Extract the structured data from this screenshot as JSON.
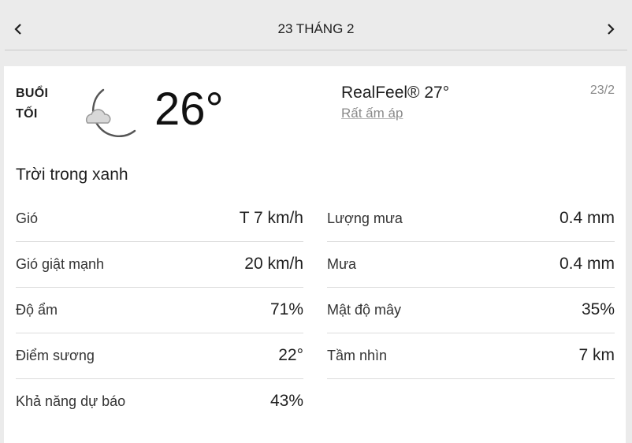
{
  "nav": {
    "prev_icon": "chevron-left-icon",
    "title": "23 THÁNG 2",
    "next_icon": "chevron-right-icon"
  },
  "forecast": {
    "period_line1": "BUỔI",
    "period_line2": "TỐI",
    "icon": "moon-cloud-icon",
    "temperature": "26°",
    "realfeel": "RealFeel® 27°",
    "realfeel_phrase": "Rất ấm áp",
    "date": "23/2",
    "condition": "Trời trong xanh"
  },
  "details_left": [
    {
      "label": "Gió",
      "value": "T 7 km/h"
    },
    {
      "label": "Gió giật mạnh",
      "value": "20 km/h"
    },
    {
      "label": "Độ ẩm",
      "value": "71%"
    },
    {
      "label": "Điểm sương",
      "value": "22°"
    },
    {
      "label": "Khả năng dự báo",
      "value": "43%"
    }
  ],
  "details_right": [
    {
      "label": "Lượng mưa",
      "value": "0.4 mm"
    },
    {
      "label": "Mưa",
      "value": "0.4 mm"
    },
    {
      "label": "Mật độ mây",
      "value": "35%"
    },
    {
      "label": "Tầm nhìn",
      "value": "7 km"
    }
  ]
}
